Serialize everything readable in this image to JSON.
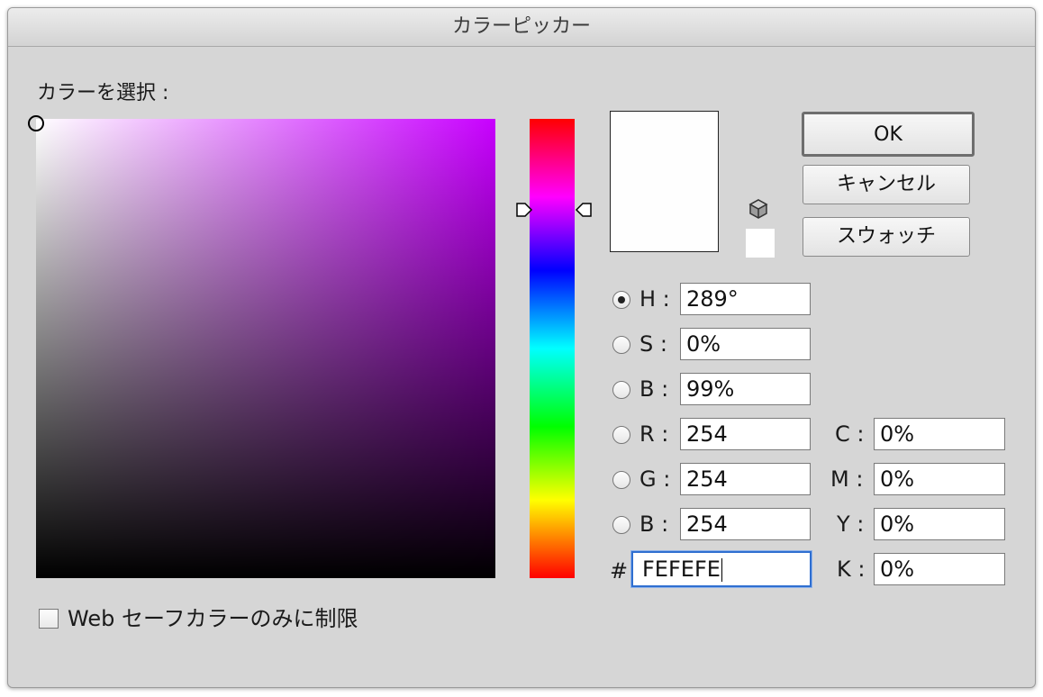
{
  "window": {
    "title": "カラーピッカー"
  },
  "picker": {
    "label": "カラーを選択 :",
    "field_hue_color": "#c800ff",
    "selected": {
      "saturation_pct": 0,
      "brightness_pct": 99
    },
    "hue_slider": {
      "value_deg": 289
    }
  },
  "preview": {
    "new_color": "#fefefe",
    "websafe_icon": "cube-icon",
    "websafe_color": "#ffffff"
  },
  "buttons": {
    "ok": "OK",
    "cancel": "キャンセル",
    "swatches": "スウォッチ"
  },
  "hsb": [
    {
      "label": "H :",
      "value": "289°",
      "checked": true
    },
    {
      "label": "S :",
      "value": "0%",
      "checked": false
    },
    {
      "label": "B :",
      "value": "99%",
      "checked": false
    }
  ],
  "rgb": [
    {
      "label": "R :",
      "value": "254",
      "checked": false
    },
    {
      "label": "G :",
      "value": "254",
      "checked": false
    },
    {
      "label": "B :",
      "value": "254",
      "checked": false
    }
  ],
  "cmyk": [
    {
      "label": "C :",
      "value": "0%"
    },
    {
      "label": "M :",
      "value": "0%"
    },
    {
      "label": "Y :",
      "value": "0%"
    },
    {
      "label": "K :",
      "value": "0%"
    }
  ],
  "hex": {
    "label": "#",
    "value": "FEFEFE"
  },
  "websafe": {
    "label": "Web セーフカラーのみに制限",
    "checked": false
  }
}
